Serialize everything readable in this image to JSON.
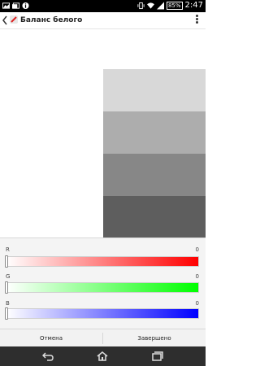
{
  "status_bar": {
    "battery": "85%",
    "time": "2:47"
  },
  "action_bar": {
    "title": "Баланс белого"
  },
  "preview": {
    "swatch_colors": [
      "#d8d8d8",
      "#adadad",
      "#878787",
      "#5e5e5e"
    ]
  },
  "sliders": [
    {
      "label": "R",
      "value": "0",
      "color": "#ff0000"
    },
    {
      "label": "G",
      "value": "0",
      "color": "#00ff00"
    },
    {
      "label": "B",
      "value": "0",
      "color": "#0000ff"
    }
  ],
  "buttons": {
    "cancel": "Отмена",
    "done": "Завершено"
  }
}
